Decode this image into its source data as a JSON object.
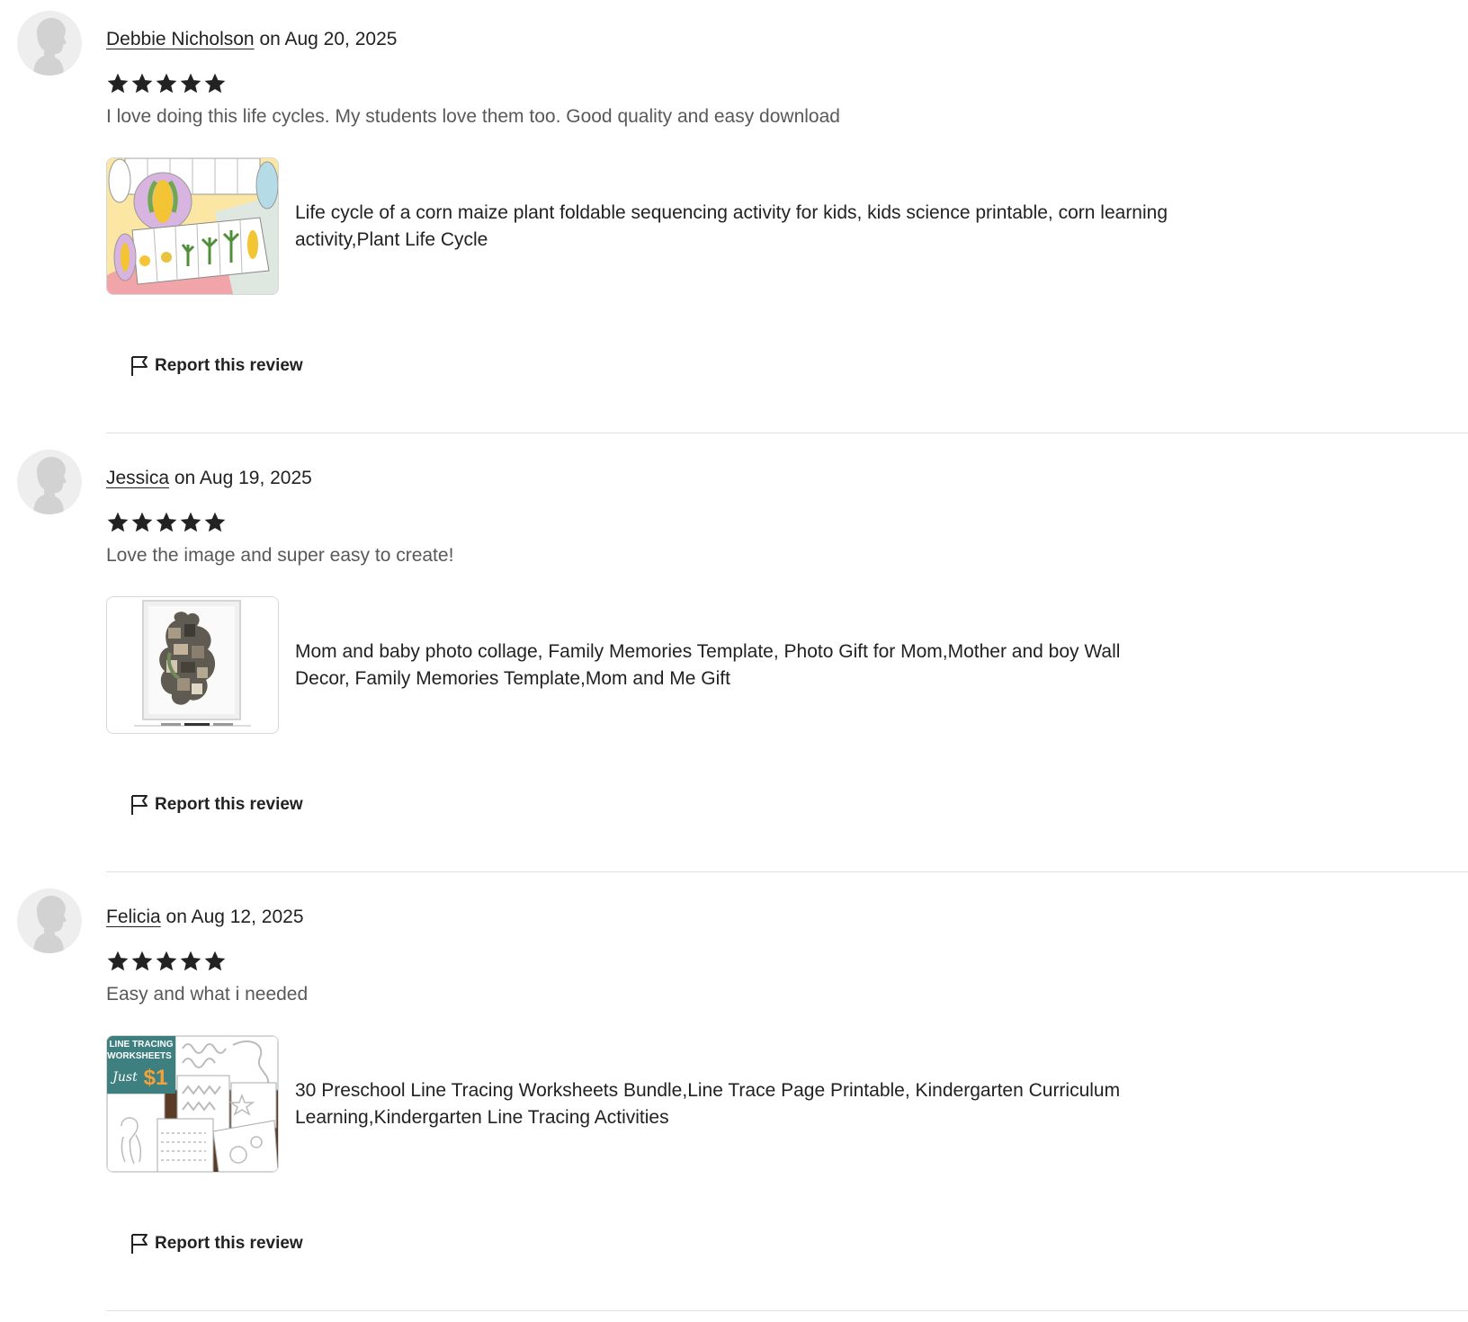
{
  "reviews": [
    {
      "reviewer": "Debbie Nicholson",
      "date_text": " on Aug 20, 2025",
      "rating": 5,
      "text": "I love doing this life cycles. My students love them too. Good quality and easy download",
      "product": {
        "title": "Life cycle of a corn maize plant foldable sequencing activity for kids, kids science printable, corn learning activity,Plant Life Cycle"
      },
      "report_label": "Report this review"
    },
    {
      "reviewer": "Jessica",
      "date_text": " on Aug 19, 2025",
      "rating": 5,
      "text": "Love the image and super easy to create!",
      "product": {
        "title": "Mom and baby photo collage, Family Memories Template, Photo Gift for Mom,Mother and boy Wall Decor, Family Memories Template,Mom and Me Gift"
      },
      "report_label": "Report this review"
    },
    {
      "reviewer": "Felicia",
      "date_text": " on Aug 12, 2025",
      "rating": 5,
      "text": "Easy and what i needed",
      "product": {
        "title": "30 Preschool Line Tracing Worksheets Bundle,Line Trace Page Printable, Kindergarten Curriculum Learning,Kindergarten Line Tracing Activities",
        "thumb_text": [
          "LINE TRACING",
          "WORKSHEETS",
          "Just",
          "$1"
        ]
      },
      "report_label": "Report this review"
    }
  ],
  "colors": {
    "text": "#222222",
    "muted_text": "#595959",
    "divider": "#e1e1e1",
    "star": "#222222",
    "avatar_bg": "#eeeeee",
    "avatar_silhouette": "#d2d2d2"
  }
}
